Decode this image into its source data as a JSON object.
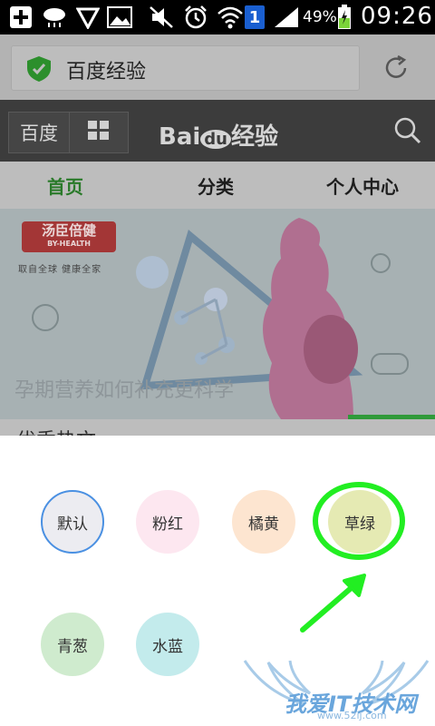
{
  "status_bar": {
    "battery_percent": "49%",
    "time": "09:26",
    "notification_badge": "1",
    "icons": [
      "add-icon",
      "cloud-rain-icon",
      "shield-check-icon",
      "image-icon",
      "mute-icon",
      "alarm-icon",
      "wifi-icon",
      "notification-badge-icon",
      "signal-icon",
      "battery-charging-icon"
    ]
  },
  "url_bar": {
    "page_title": "百度经验"
  },
  "top_nav": {
    "baidu_button": "百度",
    "logo_prefix": "Bai",
    "logo_du": "du",
    "logo_suffix": "经验"
  },
  "tabs": [
    {
      "label": "首页",
      "active": true
    },
    {
      "label": "分类",
      "active": false
    },
    {
      "label": "个人中心",
      "active": false
    }
  ],
  "banner": {
    "brand_name": "汤臣倍健",
    "brand_sub": "BY-HEALTH",
    "slogan": "取自全球 健康全家",
    "title": "孕期营养如何补充更科学",
    "slide_progress": 0.2
  },
  "section_heading": "优秀热文",
  "theme_options": [
    {
      "label": "默认",
      "color": "#ececf1",
      "selected": true
    },
    {
      "label": "粉红",
      "color": "#fde7f0",
      "selected": false
    },
    {
      "label": "橘黄",
      "color": "#fde5d0",
      "selected": false
    },
    {
      "label": "草绿",
      "color": "#e5eab3",
      "selected": false
    },
    {
      "label": "青葱",
      "color": "#cfebce",
      "selected": false
    },
    {
      "label": "水蓝",
      "color": "#c3ebec",
      "selected": false
    }
  ],
  "colors": {
    "accent_green": "#22ee22",
    "selected_border": "#4a90e2"
  },
  "watermark": {
    "text": "我爱IT技术网",
    "url": "www.52ij.com"
  }
}
